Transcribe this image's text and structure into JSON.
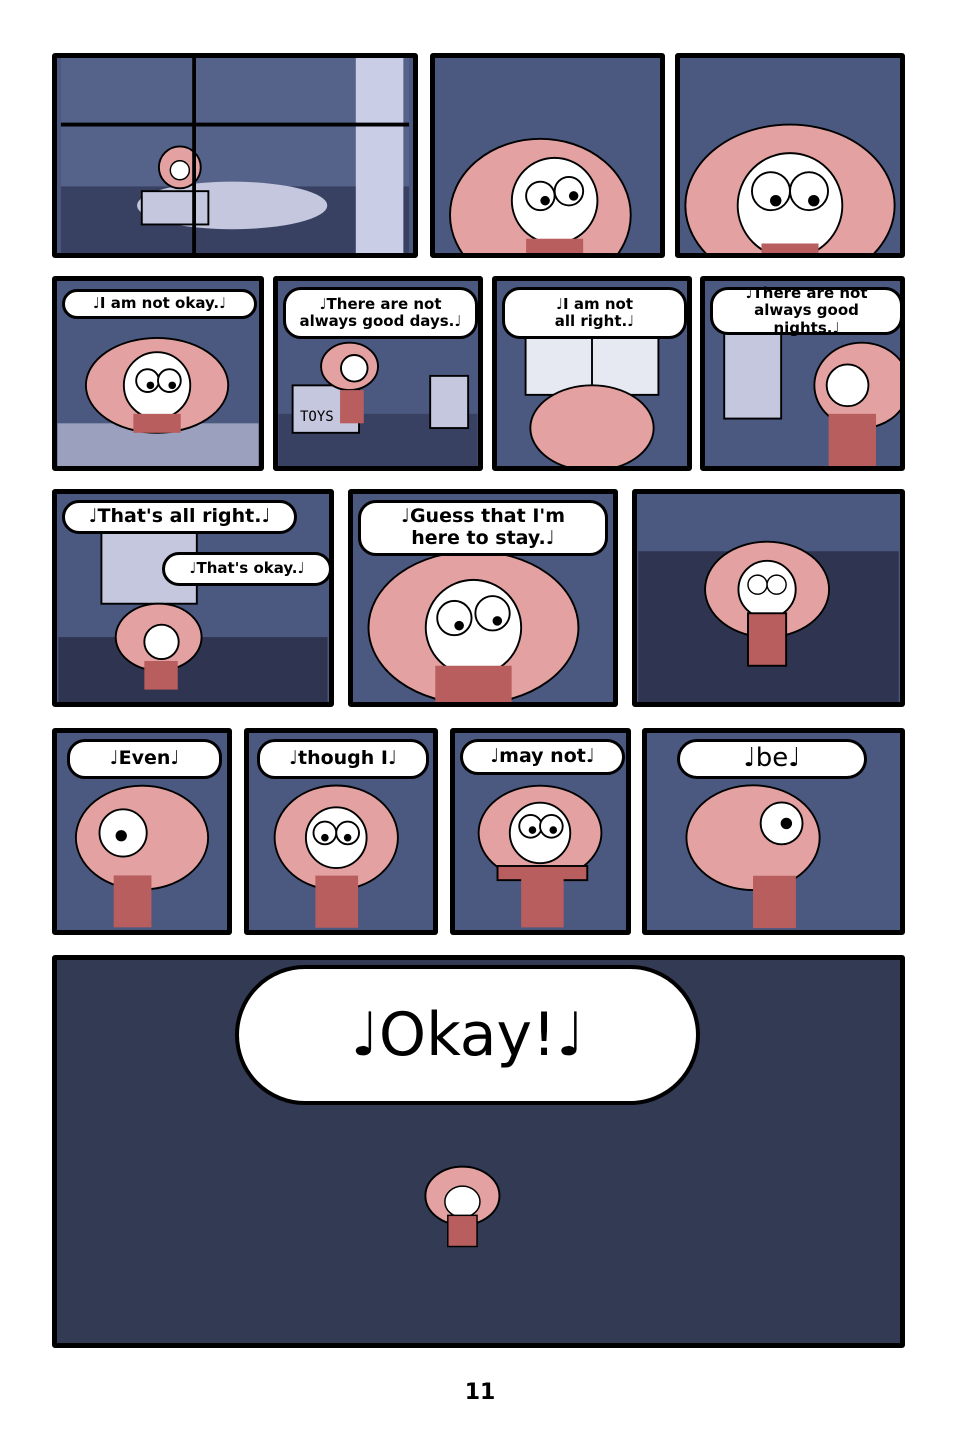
{
  "colors": {
    "wall": "#4b5880",
    "wall_dark": "#3a4266",
    "floor": "#2f3550",
    "hair": "#e3a1a1",
    "shirt": "#b85e5e",
    "skin": "#ffffff",
    "outline": "#000000"
  },
  "rows": [
    {
      "panels": [
        {
          "scene": "bedroom-window"
        },
        {
          "scene": "girl-face-close"
        },
        {
          "scene": "girl-face-closer"
        }
      ]
    },
    {
      "panels": [
        {
          "scene": "girl-at-desk",
          "lyric": "♩I am not okay.♩"
        },
        {
          "scene": "girl-by-toys",
          "lyric": "♩There are not\nalways good days.♩",
          "toys_label": "TOYS"
        },
        {
          "scene": "girl-at-window",
          "lyric": "♩I am not\nall right.♩"
        },
        {
          "scene": "girl-pulls-curtain",
          "lyric": "♩There are not\nalways good nights.♩"
        }
      ]
    },
    {
      "panels": [
        {
          "scene": "girl-by-curtain",
          "lyric": "♩That's all right.♩",
          "lyric2": "♩That's okay.♩"
        },
        {
          "scene": "girl-center",
          "lyric": "♩Guess that I'm\nhere to stay.♩"
        },
        {
          "scene": "girl-standing"
        }
      ]
    },
    {
      "panels": [
        {
          "scene": "girl-side",
          "lyric": "♩Even♩"
        },
        {
          "scene": "girl-front",
          "lyric": "♩though I♩"
        },
        {
          "scene": "girl-arms-out",
          "lyric": "♩may not♩"
        },
        {
          "scene": "girl-turning",
          "lyric": "♩be♩"
        }
      ]
    },
    {
      "panels": [
        {
          "scene": "girl-far-away",
          "lyric": "♩Okay!♩"
        }
      ]
    }
  ],
  "page_number": "11"
}
